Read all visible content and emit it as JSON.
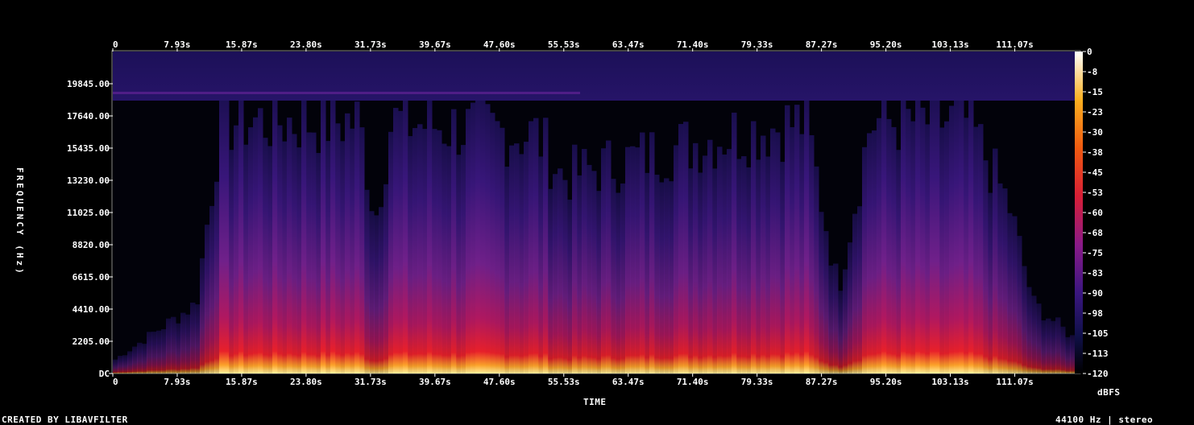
{
  "chart_data": {
    "type": "heatmap",
    "subtype": "spectrogram",
    "x_ticks": [
      "0",
      "7.93s",
      "15.87s",
      "23.80s",
      "31.73s",
      "39.67s",
      "47.60s",
      "55.53s",
      "63.47s",
      "71.40s",
      "79.33s",
      "87.27s",
      "95.20s",
      "103.13s",
      "111.07s"
    ],
    "y_ticks": [
      "DC",
      "2205.00",
      "4410.00",
      "6615.00",
      "8820.00",
      "11025.00",
      "13230.00",
      "15435.00",
      "17640.00",
      "19845.00"
    ],
    "xlabel": "TIME",
    "ylabel": "FREQUENCY (Hz)",
    "xlim": [
      0,
      119
    ],
    "ylim": [
      0,
      22050
    ],
    "colorbar": {
      "label": "dBFS",
      "ticks": [
        "0",
        "-8",
        "-15",
        "-23",
        "-30",
        "-38",
        "-45",
        "-53",
        "-60",
        "-68",
        "-75",
        "-83",
        "-90",
        "-98",
        "-105",
        "-113",
        "-120"
      ],
      "range": [
        -120,
        0
      ],
      "colors": [
        "#000000",
        "#10104a",
        "#3a1680",
        "#8a1a88",
        "#d81e36",
        "#f05a10",
        "#fcb020",
        "#fff8c0",
        "#ffffff"
      ]
    },
    "energy_profile_seconds": [
      {
        "t": 0,
        "level": 0.05
      },
      {
        "t": 5,
        "level": 0.15
      },
      {
        "t": 10,
        "level": 0.25
      },
      {
        "t": 13,
        "level": 0.9
      },
      {
        "t": 30,
        "level": 0.9
      },
      {
        "t": 32,
        "level": 0.55
      },
      {
        "t": 34,
        "level": 0.9
      },
      {
        "t": 52,
        "level": 0.85
      },
      {
        "t": 55,
        "level": 0.7
      },
      {
        "t": 75,
        "level": 0.85
      },
      {
        "t": 85,
        "level": 0.9
      },
      {
        "t": 89,
        "level": 0.3
      },
      {
        "t": 93,
        "level": 0.9
      },
      {
        "t": 105,
        "level": 0.9
      },
      {
        "t": 110,
        "level": 0.6
      },
      {
        "t": 113,
        "level": 0.25
      },
      {
        "t": 119,
        "level": 0.1
      }
    ],
    "band_cutoff_hz": 19200
  },
  "footer": {
    "left": "CREATED BY LIBAVFILTER",
    "right": "44100 Hz | stereo"
  }
}
